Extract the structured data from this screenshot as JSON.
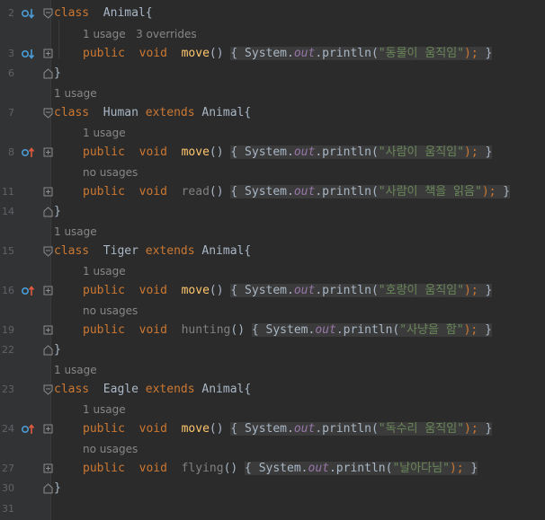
{
  "editor": {
    "line_numbers": [
      "2",
      "3",
      "6",
      "7",
      "8",
      "11",
      "14",
      "15",
      "16",
      "19",
      "22",
      "23",
      "24",
      "27",
      "30",
      "31"
    ],
    "hints": {
      "usage_1": "1 usage",
      "usage_1_overrides": "1 usage   3 overrides",
      "no_usages": "no usages"
    },
    "keywords": {
      "class": "class",
      "public": "public",
      "void": "void",
      "extends": "extends"
    },
    "code_tokens": {
      "system": "System.",
      "out": "out",
      "println": ".println(",
      "close": ");",
      "open_brace": "{",
      "close_brace": "}",
      "parens": "()"
    },
    "classes": [
      {
        "name": "Animal{",
        "methods": [
          {
            "name": "move",
            "string": "\"동물이 움직임\""
          }
        ]
      },
      {
        "name": "Human",
        "base": "Animal{",
        "methods": [
          {
            "name": "move",
            "string": "\"사람이 움직임\""
          },
          {
            "name": "read",
            "string": "\"사람이 책을 읽음\""
          }
        ]
      },
      {
        "name": "Tiger",
        "base": "Animal{",
        "methods": [
          {
            "name": "move",
            "string": "\"호랑이 움직임\""
          },
          {
            "name": "hunting",
            "string": "\"사냥을 함\""
          }
        ]
      },
      {
        "name": "Eagle",
        "base": "Animal{",
        "methods": [
          {
            "name": "move",
            "string": "\"독수리 움직임\""
          },
          {
            "name": "flying",
            "string": "\"날아다님\""
          }
        ]
      }
    ],
    "colors": {
      "background": "#2b2b2b",
      "keyword": "#cc7832",
      "method": "#ffc66d",
      "string": "#6a8759",
      "field": "#9876aa",
      "gutter_icon": "#4a9cd6",
      "override_arrow": "#e05b3d"
    },
    "icons": [
      "implemented-down-icon",
      "overrides-up-icon",
      "fold-icon"
    ]
  }
}
